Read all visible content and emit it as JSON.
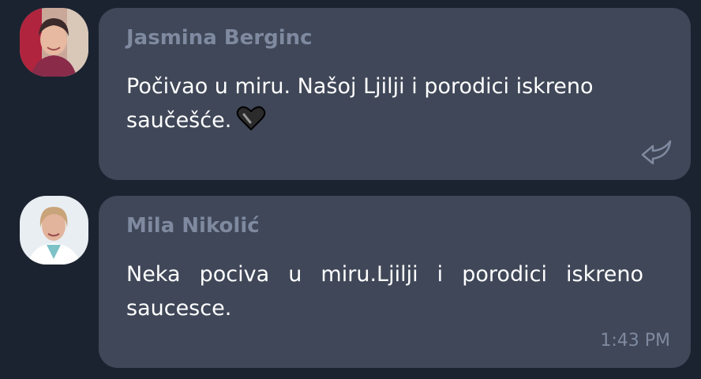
{
  "messages": [
    {
      "sender": "Jasmina Berginc",
      "text": "Počivao u miru. Našoj Ljilji i porodici iskreno saučešće.",
      "emoji_icon": "black-heart-icon",
      "action_icon": "reply-arrow-icon"
    },
    {
      "sender": "Mila Nikolić",
      "text": "Neka pociva u miru.Ljilji i porodici iskreno saucesce.",
      "time": "1:43 PM"
    }
  ],
  "colors": {
    "background": "#1c2330",
    "bubble": "#3f4758",
    "sender_name": "#7f8aa0",
    "message_text": "#ffffff",
    "timestamp": "#7f8aa0"
  }
}
